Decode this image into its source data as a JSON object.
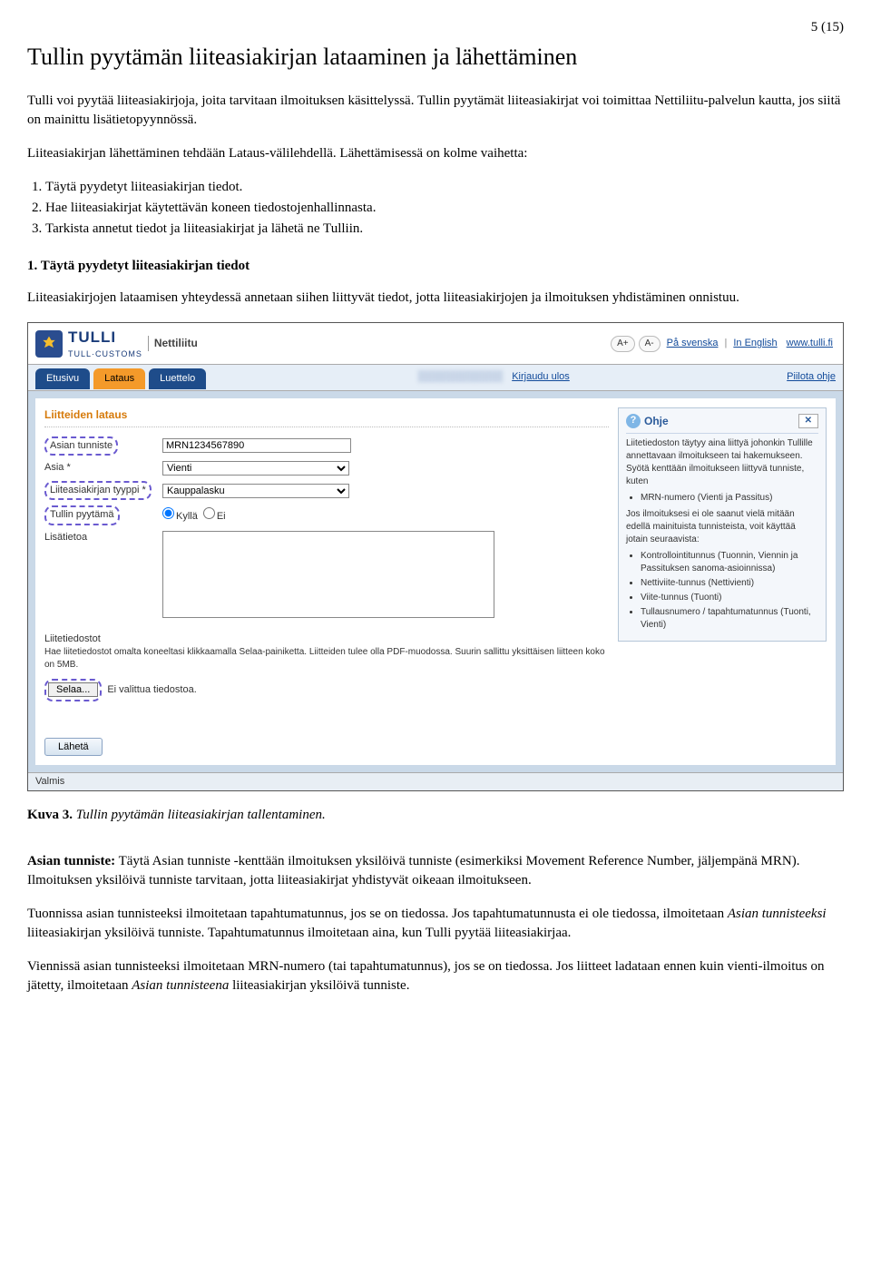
{
  "page_number": "5 (15)",
  "title": "Tullin pyytämän liiteasiakirjan lataaminen ja lähettäminen",
  "intro_p1": "Tulli voi pyytää liiteasiakirjoja, joita tarvitaan ilmoituksen käsittelyssä. Tullin pyytämät liiteasiakirjat voi toimittaa Nettiliitu-palvelun kautta, jos siitä on mainittu lisätietopyynnössä.",
  "intro_p2": "Liiteasiakirjan lähettäminen tehdään Lataus-välilehdellä. Lähettämisessä on kolme vaihetta:",
  "steps": [
    "Täytä pyydetyt liiteasiakirjan tiedot.",
    "Hae liiteasiakirjat käytettävän koneen tiedostojenhallinnasta.",
    "Tarkista annetut tiedot ja liiteasiakirjat ja lähetä ne Tulliin."
  ],
  "section1_heading": "1.   Täytä pyydetyt liiteasiakirjan tiedot",
  "section1_p": "Liiteasiakirjojen lataamisen yhteydessä annetaan siihen liittyvät tiedot, jotta liiteasiakirjojen ja ilmoituksen yhdistäminen onnistuu.",
  "caption_bold": "Kuva 3.",
  "caption_italic": " Tullin pyytämän liiteasiakirjan tallentaminen.",
  "body_p1_strong": "Asian tunniste:",
  "body_p1": " Täytä Asian tunniste -kenttään ilmoituksen yksilöivä tunniste (esimerkiksi Movement Reference Number, jäljempänä MRN). Ilmoituksen yksilöivä tunniste tarvitaan, jotta liiteasiakirjat yhdistyvät oikeaan ilmoitukseen.",
  "body_p2a": "Tuonnissa asian tunnisteeksi ilmoitetaan tapahtumatunnus, jos se on tiedossa. Jos tapahtumatunnusta ei ole tiedossa, ilmoitetaan ",
  "body_p2_i1": "Asian tunnisteeksi",
  "body_p2b": " liiteasiakirjan yksilöivä tunniste. Tapahtumatunnus ilmoitetaan aina, kun Tulli pyytää liiteasiakirjaa.",
  "body_p3a": "Viennissä asian tunnisteeksi ilmoitetaan MRN-numero (tai tapahtumatunnus), jos se on tiedossa. Jos liitteet ladataan ennen kuin vienti-ilmoitus on jätetty, ilmoitetaan ",
  "body_p3_i1": "Asian tunnisteena",
  "body_p3b": " liiteasiakirjan yksilöivä tunniste.",
  "screenshot": {
    "brand1": "TULLI",
    "brand2": "TULL·CUSTOMS",
    "service": "Nettiliitu",
    "font_plus": "A+",
    "font_minus": "A-",
    "lang1": "På svenska",
    "lang2": "In English",
    "site": "www.tulli.fi",
    "tabs": {
      "t1": "Etusivu",
      "t2": "Lataus",
      "t3": "Luettelo"
    },
    "logout": "Kirjaudu ulos",
    "hide_help": "Piilota ohje",
    "panel_title": "Liitteiden lataus",
    "labels": {
      "tunniste": "Asian tunniste",
      "asia": "Asia *",
      "tyyppi": "Liiteasiakirjan tyyppi *",
      "pyytama": "Tullin pyytämä",
      "lisatietoa": "Lisätietoa"
    },
    "values": {
      "tunniste": "MRN1234567890",
      "asia": "Vienti",
      "tyyppi": "Kauppalasku",
      "radio_yes": "Kyllä",
      "radio_no": "Ei"
    },
    "attach_label": "Liitetiedostot",
    "attach_note": "Hae liitetiedostot omalta koneeltasi klikkaamalla Selaa-painiketta. Liitteiden tulee olla PDF-muodossa. Suurin sallittu yksittäisen liitteen koko on 5MB.",
    "browse": "Selaa...",
    "no_file": "Ei valittua tiedostoa.",
    "submit": "Lähetä",
    "status": "Valmis",
    "help": {
      "title": "Ohje",
      "p1": "Liitetiedoston täytyy aina liittyä johonkin Tullille annettavaan ilmoitukseen tai hakemukseen. Syötä kenttään ilmoitukseen liittyvä tunniste, kuten",
      "li1": "MRN-numero (Vienti ja Passitus)",
      "p2": "Jos ilmoituksesi ei ole saanut vielä mitään edellä mainituista tunnisteista, voit käyttää jotain seuraavista:",
      "li2a": "Kontrollointitunnus (Tuonnin, Viennin ja Passituksen sanoma-asioinnissa)",
      "li2b": "Nettiviite-tunnus (Nettivienti)",
      "li2c": "Viite-tunnus (Tuonti)",
      "li2d": "Tullausnumero / tapahtumatunnus (Tuonti, Vienti)"
    }
  }
}
